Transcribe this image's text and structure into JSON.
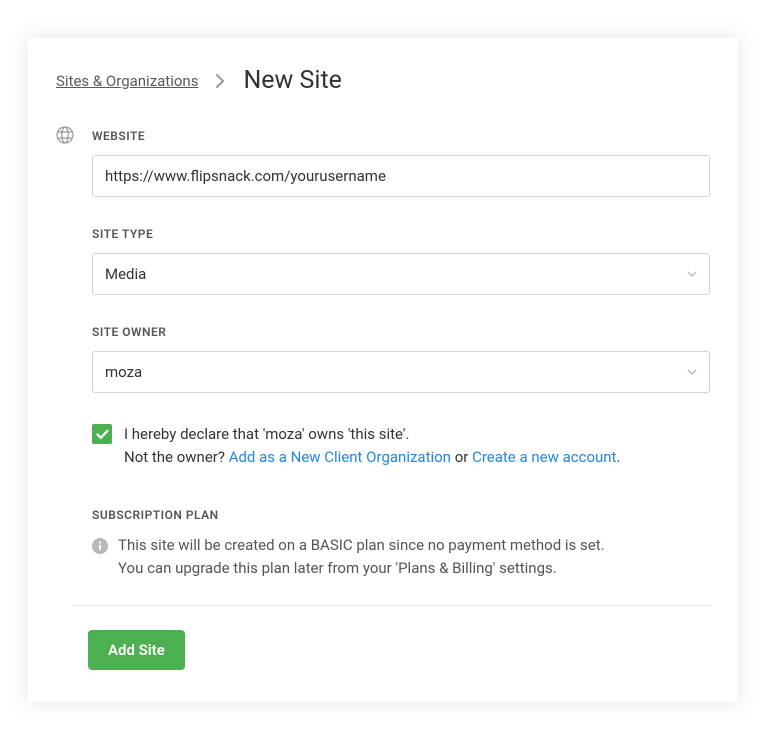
{
  "breadcrumb": {
    "parent": "Sites & Organizations",
    "current": "New Site"
  },
  "form": {
    "website": {
      "label": "WEBSITE",
      "value": "https://www.flipsnack.com/yourusername"
    },
    "site_type": {
      "label": "SITE TYPE",
      "value": "Media"
    },
    "site_owner": {
      "label": "SITE OWNER",
      "value": "moza"
    },
    "ownership": {
      "checked": true,
      "declare": "I hereby declare that 'moza' owns 'this site'.",
      "not_owner_prefix": "Not the owner? ",
      "add_client_link": "Add as a New Client Organization",
      "or": " or ",
      "create_account_link": "Create a new account",
      "suffix": "."
    },
    "plan": {
      "label": "SUBSCRIPTION PLAN",
      "line1": "This site will be created on a BASIC plan since no payment method is set.",
      "line2": "You can upgrade this plan later from your 'Plans & Billing' settings."
    }
  },
  "actions": {
    "add_site": "Add Site"
  }
}
